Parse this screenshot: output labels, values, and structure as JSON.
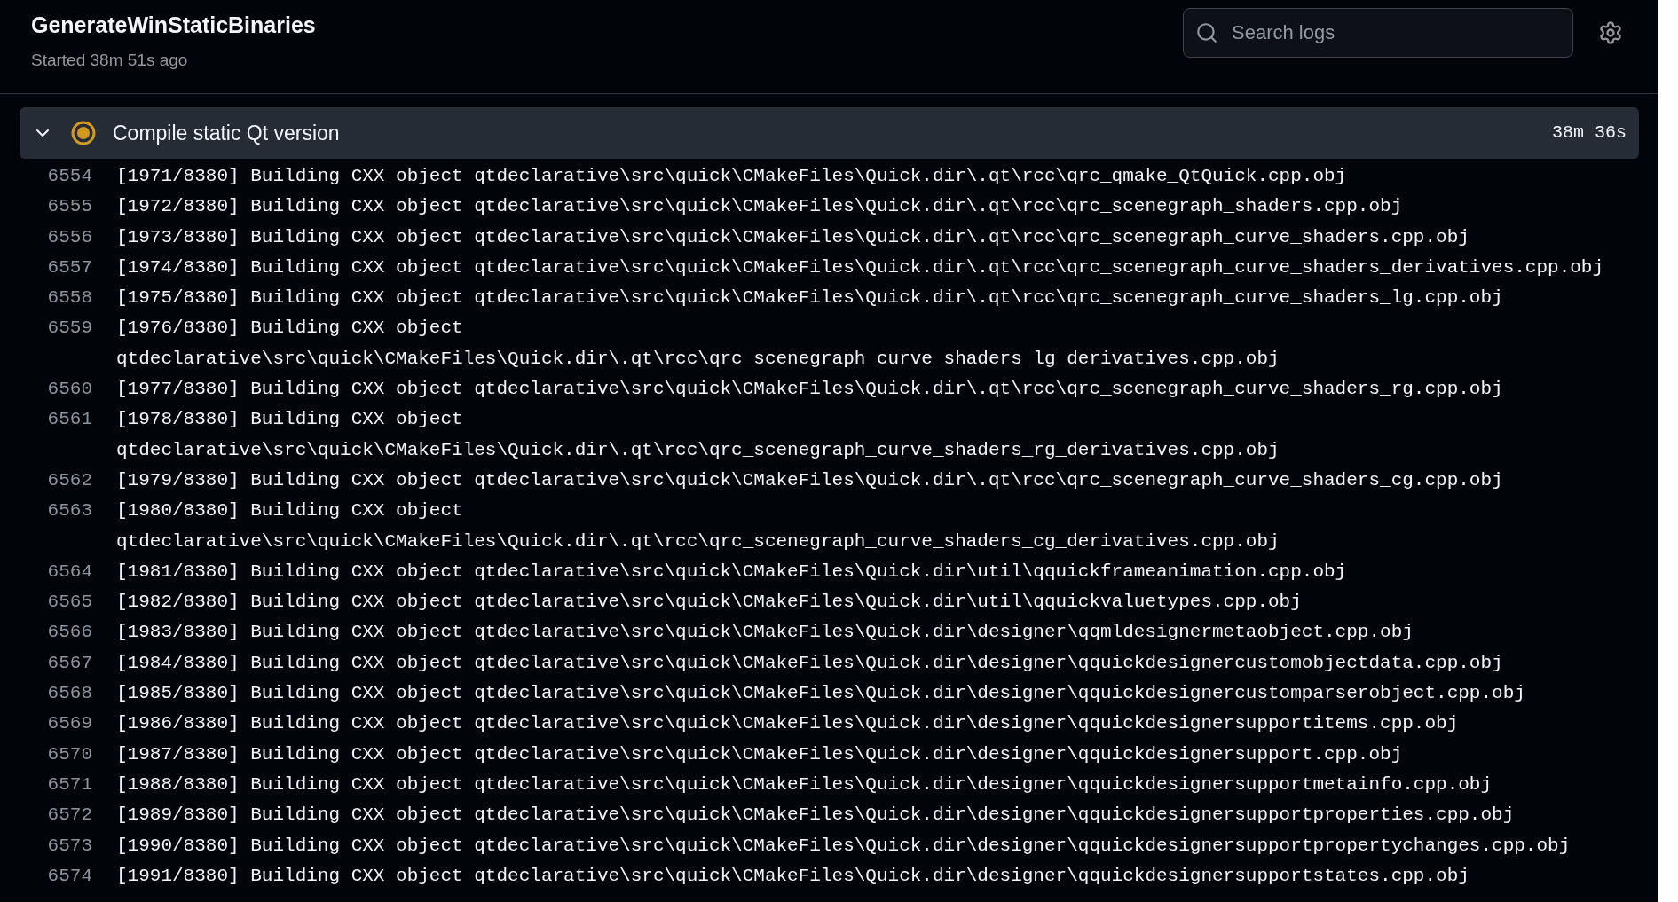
{
  "job": {
    "title": "GenerateWinStaticBinaries",
    "subtitle": "Started 38m 51s ago"
  },
  "search": {
    "placeholder": "Search logs"
  },
  "step": {
    "title": "Compile static Qt version",
    "duration": "38m 36s",
    "expanded": true,
    "kind": "in_progress"
  },
  "lines": [
    {
      "number": "6554",
      "text": "[1971/8380] Building CXX object qtdeclarative\\src\\quick\\CMakeFiles\\Quick.dir\\.qt\\rcc\\qrc_qmake_QtQuick.cpp.obj"
    },
    {
      "number": "6555",
      "text": "[1972/8380] Building CXX object qtdeclarative\\src\\quick\\CMakeFiles\\Quick.dir\\.qt\\rcc\\qrc_scenegraph_shaders.cpp.obj"
    },
    {
      "number": "6556",
      "text": "[1973/8380] Building CXX object qtdeclarative\\src\\quick\\CMakeFiles\\Quick.dir\\.qt\\rcc\\qrc_scenegraph_curve_shaders.cpp.obj"
    },
    {
      "number": "6557",
      "text": "[1974/8380] Building CXX object qtdeclarative\\src\\quick\\CMakeFiles\\Quick.dir\\.qt\\rcc\\qrc_scenegraph_curve_shaders_derivatives.cpp.obj"
    },
    {
      "number": "6558",
      "text": "[1975/8380] Building CXX object qtdeclarative\\src\\quick\\CMakeFiles\\Quick.dir\\.qt\\rcc\\qrc_scenegraph_curve_shaders_lg.cpp.obj"
    },
    {
      "number": "6559",
      "text": "[1976/8380] Building CXX object qtdeclarative\\src\\quick\\CMakeFiles\\Quick.dir\\.qt\\rcc\\qrc_scenegraph_curve_shaders_lg_derivatives.cpp.obj"
    },
    {
      "number": "6560",
      "text": "[1977/8380] Building CXX object qtdeclarative\\src\\quick\\CMakeFiles\\Quick.dir\\.qt\\rcc\\qrc_scenegraph_curve_shaders_rg.cpp.obj"
    },
    {
      "number": "6561",
      "text": "[1978/8380] Building CXX object qtdeclarative\\src\\quick\\CMakeFiles\\Quick.dir\\.qt\\rcc\\qrc_scenegraph_curve_shaders_rg_derivatives.cpp.obj"
    },
    {
      "number": "6562",
      "text": "[1979/8380] Building CXX object qtdeclarative\\src\\quick\\CMakeFiles\\Quick.dir\\.qt\\rcc\\qrc_scenegraph_curve_shaders_cg.cpp.obj"
    },
    {
      "number": "6563",
      "text": "[1980/8380] Building CXX object qtdeclarative\\src\\quick\\CMakeFiles\\Quick.dir\\.qt\\rcc\\qrc_scenegraph_curve_shaders_cg_derivatives.cpp.obj"
    },
    {
      "number": "6564",
      "text": "[1981/8380] Building CXX object qtdeclarative\\src\\quick\\CMakeFiles\\Quick.dir\\util\\qquickframeanimation.cpp.obj"
    },
    {
      "number": "6565",
      "text": "[1982/8380] Building CXX object qtdeclarative\\src\\quick\\CMakeFiles\\Quick.dir\\util\\qquickvaluetypes.cpp.obj"
    },
    {
      "number": "6566",
      "text": "[1983/8380] Building CXX object qtdeclarative\\src\\quick\\CMakeFiles\\Quick.dir\\designer\\qqmldesignermetaobject.cpp.obj"
    },
    {
      "number": "6567",
      "text": "[1984/8380] Building CXX object qtdeclarative\\src\\quick\\CMakeFiles\\Quick.dir\\designer\\qquickdesignercustomobjectdata.cpp.obj"
    },
    {
      "number": "6568",
      "text": "[1985/8380] Building CXX object qtdeclarative\\src\\quick\\CMakeFiles\\Quick.dir\\designer\\qquickdesignercustomparserobject.cpp.obj"
    },
    {
      "number": "6569",
      "text": "[1986/8380] Building CXX object qtdeclarative\\src\\quick\\CMakeFiles\\Quick.dir\\designer\\qquickdesignersupportitems.cpp.obj"
    },
    {
      "number": "6570",
      "text": "[1987/8380] Building CXX object qtdeclarative\\src\\quick\\CMakeFiles\\Quick.dir\\designer\\qquickdesignersupport.cpp.obj"
    },
    {
      "number": "6571",
      "text": "[1988/8380] Building CXX object qtdeclarative\\src\\quick\\CMakeFiles\\Quick.dir\\designer\\qquickdesignersupportmetainfo.cpp.obj"
    },
    {
      "number": "6572",
      "text": "[1989/8380] Building CXX object qtdeclarative\\src\\quick\\CMakeFiles\\Quick.dir\\designer\\qquickdesignersupportproperties.cpp.obj"
    },
    {
      "number": "6573",
      "text": "[1990/8380] Building CXX object qtdeclarative\\src\\quick\\CMakeFiles\\Quick.dir\\designer\\qquickdesignersupportpropertychanges.cpp.obj"
    },
    {
      "number": "6574",
      "text": "[1991/8380] Building CXX object qtdeclarative\\src\\quick\\CMakeFiles\\Quick.dir\\designer\\qquickdesignersupportstates.cpp.obj"
    }
  ]
}
